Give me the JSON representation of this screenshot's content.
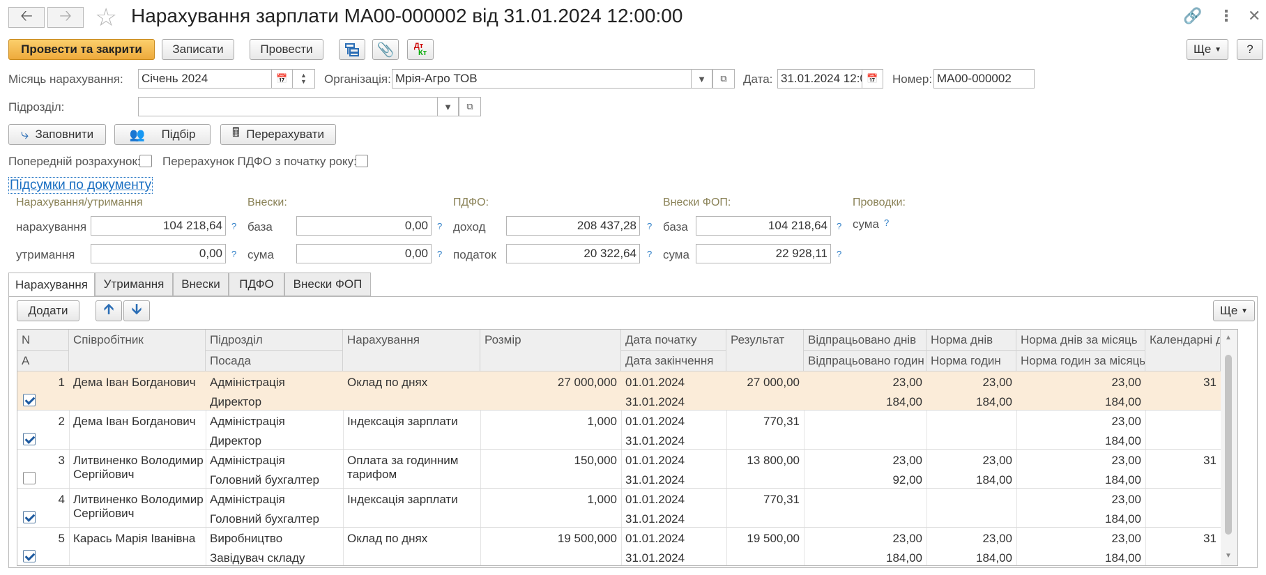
{
  "header": {
    "back_icon": "arrow-left-icon",
    "forward_icon": "arrow-right-icon",
    "favorite_icon": "star-icon",
    "title": "Нарахування зарплати МА00-000002 від 31.01.2024 12:00:00"
  },
  "toolbar": {
    "post_close": "Провести та закрити",
    "save": "Записати",
    "post": "Провести",
    "more": "Ще",
    "help": "?"
  },
  "form": {
    "month_label": "Місяць нарахування:",
    "month_value": "Січень 2024",
    "org_label": "Організація:",
    "org_value": "Мрія-Агро ТОВ",
    "date_label": "Дата:",
    "date_value": "31.01.2024 12:0",
    "number_label": "Номер:",
    "number_value": "МА00-000002",
    "dept_label": "Підрозділ:",
    "dept_value": ""
  },
  "actions": {
    "fill": "Заповнити",
    "select": "Підбір",
    "recalc": "Перерахувати"
  },
  "checks": {
    "prelim_label": "Попередній розрахунок:",
    "prelim": false,
    "pdfo_label": "Перерахунок ПДФО з початку року:",
    "pdfo": false
  },
  "totals": {
    "link": "Підсумки по документу",
    "acc_title": "Нарахування/утримання",
    "accrual_label": "нарахування",
    "accrual_value": "104 218,64",
    "deduct_label": "утримання",
    "deduct_value": "0,00",
    "contrib_title": "Внески:",
    "base_label": "база",
    "contrib_base": "0,00",
    "sum_label": "сума",
    "contrib_sum": "0,00",
    "pdfo_title": "ПДФО:",
    "income_label": "доход",
    "income_value": "208 437,28",
    "tax_label": "податок",
    "tax_value": "20 322,64",
    "fop_title": "Внески ФОП:",
    "fop_base_label": "база",
    "fop_base": "104 218,64",
    "fop_sum_label": "сума",
    "fop_sum": "22 928,11",
    "postings_title": "Проводки:",
    "postings_sum_label": "сума",
    "q": "?"
  },
  "tabs": [
    "Нарахування",
    "Утримання",
    "Внески",
    "ПДФО",
    "Внески ФОП"
  ],
  "table_toolbar": {
    "add": "Додати",
    "more": "Ще"
  },
  "table": {
    "headers_top": [
      "N",
      "Співробітник",
      "Підрозділ",
      "Нарахування",
      "Розмір",
      "Дата початку",
      "Результат",
      "Відпрацьовано днів",
      "Норма днів",
      "Норма днів за місяць",
      "Календарні дні"
    ],
    "headers_bottom": [
      "А",
      "",
      "Посада",
      "",
      "",
      "Дата закінчення",
      "",
      "Відпрацьовано годин",
      "Норма годин",
      "Норма годин за місяць",
      ""
    ],
    "rows": [
      {
        "n": "1",
        "active": true,
        "employee": "Дема Іван Богданович",
        "dept": "Адміністрація",
        "position": "Директор",
        "accrual": "Оклад по днях",
        "size": "27 000,000",
        "start": "01.01.2024",
        "end": "31.01.2024",
        "result": "27 000,00",
        "days": "23,00",
        "hours": "184,00",
        "norm_days": "23,00",
        "norm_hours": "184,00",
        "mdays": "23,00",
        "mhours": "184,00",
        "cal": "31"
      },
      {
        "n": "2",
        "active": true,
        "employee": "Дема Іван Богданович",
        "dept": "Адміністрація",
        "position": "Директор",
        "accrual": "Індексація зарплати",
        "size": "1,000",
        "start": "01.01.2024",
        "end": "31.01.2024",
        "result": "770,31",
        "days": "",
        "hours": "",
        "norm_days": "",
        "norm_hours": "",
        "mdays": "23,00",
        "mhours": "184,00",
        "cal": ""
      },
      {
        "n": "3",
        "active": false,
        "employee": "Литвиненко Володимир Сергійович",
        "dept": "Адміністрація",
        "position": "Головний бухгалтер",
        "accrual": "Оплата за годинним тарифом",
        "size": "150,000",
        "start": "01.01.2024",
        "end": "31.01.2024",
        "result": "13 800,00",
        "days": "23,00",
        "hours": "92,00",
        "norm_days": "23,00",
        "norm_hours": "184,00",
        "mdays": "23,00",
        "mhours": "184,00",
        "cal": "31"
      },
      {
        "n": "4",
        "active": true,
        "employee": "Литвиненко Володимир Сергійович",
        "dept": "Адміністрація",
        "position": "Головний бухгалтер",
        "accrual": "Індексація зарплати",
        "size": "1,000",
        "start": "01.01.2024",
        "end": "31.01.2024",
        "result": "770,31",
        "days": "",
        "hours": "",
        "norm_days": "",
        "norm_hours": "",
        "mdays": "23,00",
        "mhours": "184,00",
        "cal": ""
      },
      {
        "n": "5",
        "active": true,
        "employee": "Карась Марія Іванівна",
        "dept": "Виробництво",
        "position": "Завідувач складу",
        "accrual": "Оклад по днях",
        "size": "19 500,000",
        "start": "01.01.2024",
        "end": "31.01.2024",
        "result": "19 500,00",
        "days": "23,00",
        "hours": "184,00",
        "norm_days": "23,00",
        "norm_hours": "184,00",
        "mdays": "23,00",
        "mhours": "184,00",
        "cal": "31"
      }
    ]
  }
}
